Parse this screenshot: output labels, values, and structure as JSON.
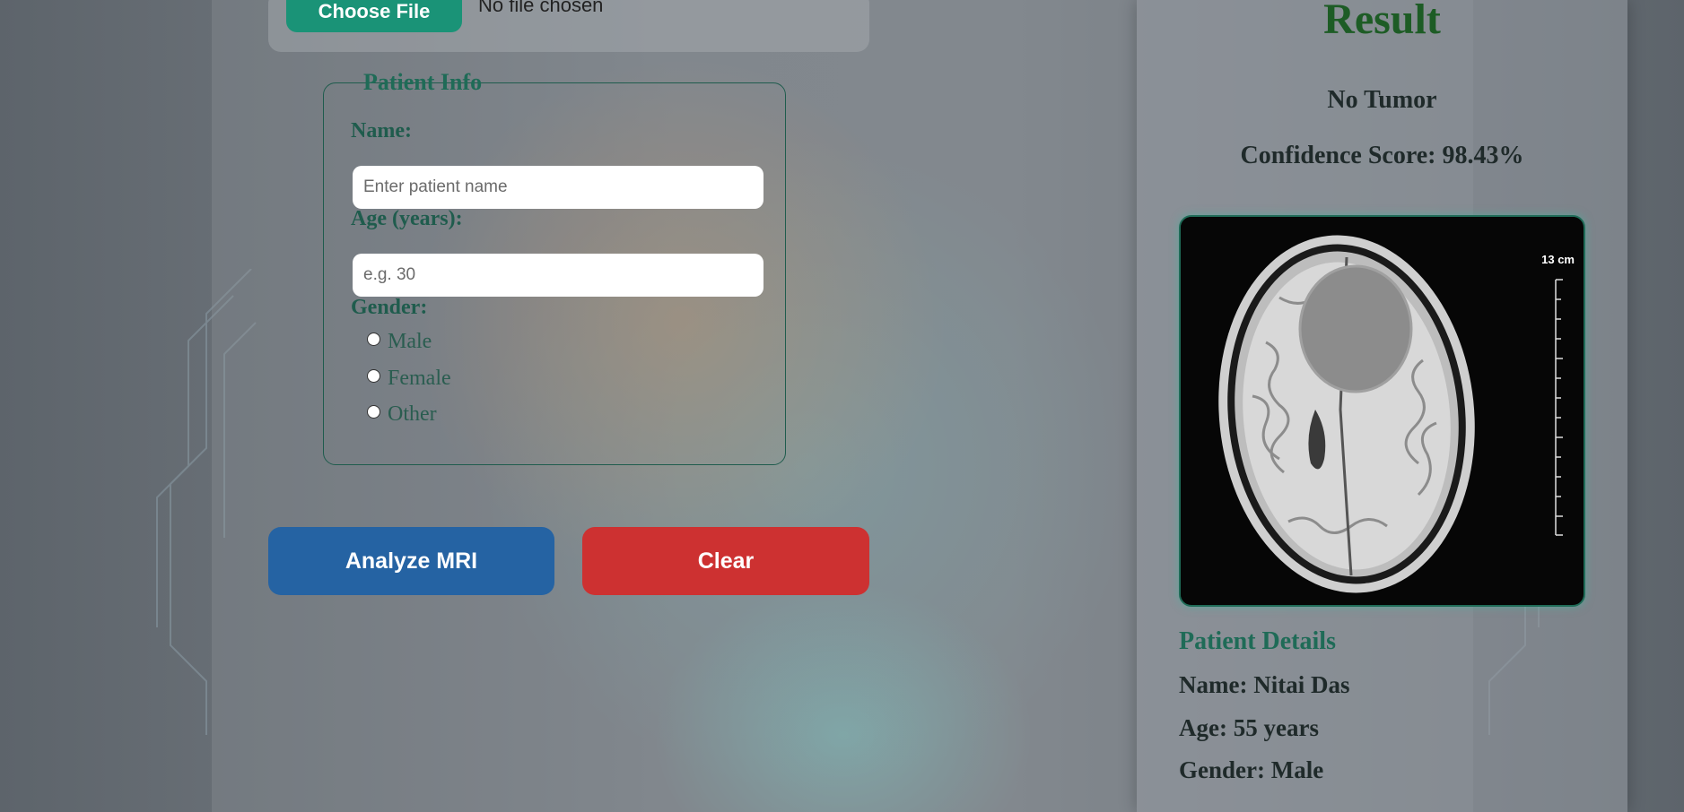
{
  "upload": {
    "button_label": "Choose File",
    "status_text": "No file chosen"
  },
  "patient_info": {
    "legend": "Patient Info",
    "name_label": "Name:",
    "name_placeholder": "Enter patient name",
    "age_label": "Age (years):",
    "age_placeholder": "e.g. 30",
    "gender_label": "Gender:",
    "gender_options": [
      "Male",
      "Female",
      "Other"
    ]
  },
  "actions": {
    "analyze_label": "Analyze MRI",
    "clear_label": "Clear"
  },
  "result": {
    "title": "Result",
    "diagnosis": "No Tumor",
    "confidence": "Confidence Score: 98.43%",
    "scan_scale_label": "13 cm",
    "patient_details_title": "Patient Details",
    "details": {
      "name": "Name: Nitai Das",
      "age": "Age: 55 years",
      "gender": "Gender: Male"
    }
  },
  "colors": {
    "choose_button": "#1a9377",
    "analyze_button": "#2563a3",
    "clear_button": "#cd3131",
    "accent_green": "#1f6b57",
    "result_title": "#1d5c25"
  },
  "icons": {
    "mri_scan": "brain-mri-image",
    "radio": "radio-unchecked-icon"
  }
}
